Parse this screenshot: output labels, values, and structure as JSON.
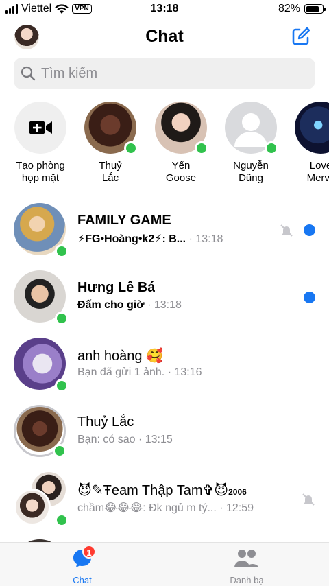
{
  "status_bar": {
    "carrier": "Viettel",
    "vpn": "VPN",
    "time": "13:18",
    "battery": "82%",
    "battery_level": 0.82
  },
  "header": {
    "title": "Chat",
    "profile_icon": "avatar",
    "compose_icon": "compose-icon"
  },
  "search": {
    "placeholder": "Tìm kiếm",
    "icon": "search-icon"
  },
  "stories": [
    {
      "label_line1": "Tạo phòng",
      "label_line2": "họp mặt",
      "icon": "video-plus-icon"
    },
    {
      "label_line1": "Thuỷ",
      "label_line2": "Lắc",
      "online": true
    },
    {
      "label_line1": "Yến",
      "label_line2": "Goose",
      "online": true
    },
    {
      "label_line1": "Nguyễn",
      "label_line2": "Dũng",
      "online": true
    },
    {
      "label_line1": "Love",
      "label_line2": "Mervy",
      "online": false
    }
  ],
  "chats": [
    {
      "name": "FAMILY GAME",
      "preview": "⚡FG•Hoàng•k2⚡: B...",
      "time": "13:18",
      "unread": true,
      "muted": true,
      "online": true
    },
    {
      "name": "Hưng Lê Bá",
      "preview": "Đấm cho giờ",
      "time": "13:18",
      "unread": true,
      "muted": false,
      "online": true
    },
    {
      "name": "anh hoàng 🥰",
      "preview": "Bạn đã gửi 1 ảnh.",
      "time": "13:16",
      "unread": false,
      "muted": false,
      "online": true
    },
    {
      "name": "Thuỷ Lắc",
      "preview": "Bạn: có sao",
      "time": "13:15",
      "unread": false,
      "muted": false,
      "online": true
    },
    {
      "name": "😈✎Ŧeam Thập Tam✞😈",
      "name_suffix": "2006",
      "preview": "chầm😂😂😂: Đk ngủ m tý...",
      "time": "12:59",
      "unread": false,
      "muted": true,
      "online": true
    }
  ],
  "tab_bar": {
    "tabs": [
      {
        "label": "Chat",
        "badge": "1",
        "active": true
      },
      {
        "label": "Danh bạ",
        "active": false
      }
    ]
  },
  "colors": {
    "accent": "#1877f2",
    "online": "#31c24d",
    "badge": "#ff3b30",
    "secondary_text": "#8e8e93"
  }
}
